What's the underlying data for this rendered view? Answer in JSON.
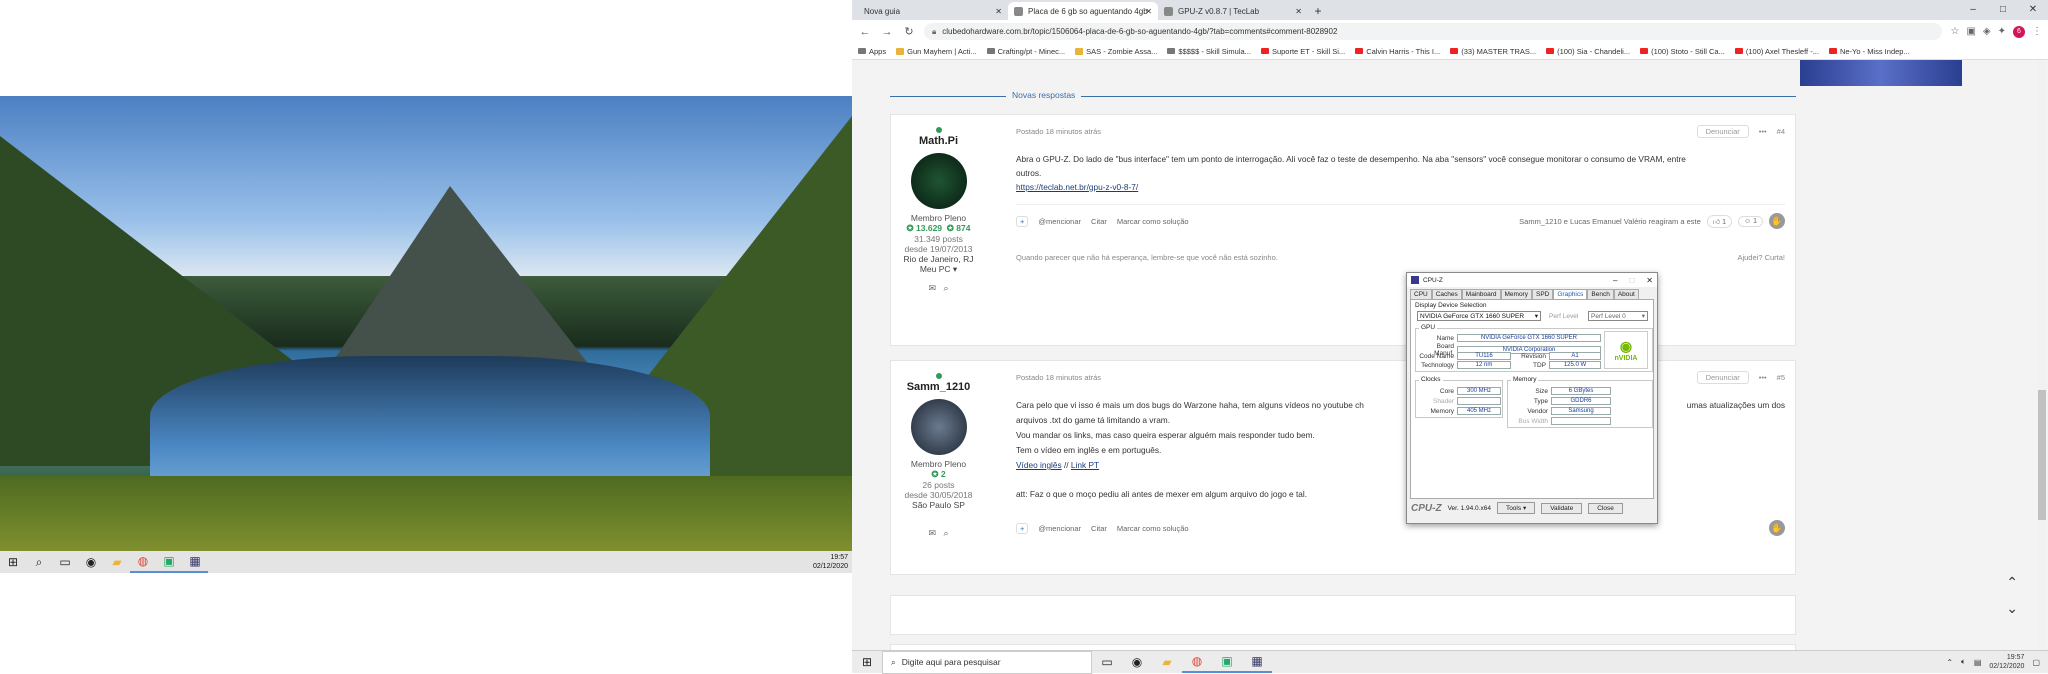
{
  "left_screen": {
    "taskbar": {
      "icons": [
        "windows-icon",
        "search-icon",
        "task-view-icon",
        "steam-icon",
        "folder-icon",
        "chrome-icon",
        "gpu-tool-icon",
        "cpuz-icon"
      ],
      "time": "19:57",
      "date": "02/12/2020"
    }
  },
  "browser": {
    "tabs": [
      {
        "label": "Nova guia",
        "active": false
      },
      {
        "label": "Placa de 6 gb so aguentando 4gb",
        "active": true
      },
      {
        "label": "GPU-Z v0.8.7 | TecLab",
        "active": false
      }
    ],
    "new_tab": "+",
    "url": "clubedohardware.com.br/topic/1506064-placa-de-6-gb-so-aguentando-4gb/?tab=comments#comment-8028902",
    "bookmarks": [
      "Apps",
      "Gun Mayhem | Acti...",
      "Crafting/pt - Minec...",
      "SAS - Zombie Assa...",
      "$$$$$ - Skill Simula...",
      "Suporte ET - Skill Si...",
      "Calvin Harris - This I...",
      "(33) MASTER TRAS...",
      "(100) Sia - Chandeli...",
      "(100) Stoto - Still Ca...",
      "(100) Axel Thesleff -...",
      "Ne-Yo - Miss Indep..."
    ],
    "avatar_letter": "6"
  },
  "forum": {
    "divider_label": "Novas respostas",
    "posts": [
      {
        "author": "Math.Pi",
        "rank": "Membro Pleno",
        "rep1": "13.629",
        "rep2": "874",
        "posts": "31.349 posts",
        "since": "desde 19/07/2013",
        "location": "Rio de Janeiro, RJ",
        "mypc": "Meu PC ▾",
        "posted": "Postado 18 minutos atrás",
        "report": "Denunciar",
        "number": "#4",
        "text1": "Abra o GPU-Z. Do lado de \"bus interface\" tem um ponto de interrogação. Ali você faz o teste de desempenho. Na aba \"sensors\" você consegue monitorar o consumo de VRAM, entre",
        "text2": "outros.",
        "link": "https://teclab.net.br/gpu-z-v0-8-7/",
        "mention": "@mencionar",
        "quote": "Citar",
        "solution": "Marcar como solução",
        "reacted": "Samm_1210 e Lucas Emanuel Valério reagiram a este",
        "react1": "1",
        "react2": "1",
        "signature": "Quando parecer que não há esperança, lembre-se que você não está sozinho.",
        "helped": "Ajudei? Curta!"
      },
      {
        "author": "Samm_1210",
        "rank": "Membro Pleno",
        "rep1": "2",
        "posts": "26 posts",
        "since": "desde 30/05/2018",
        "location": "São Paulo SP",
        "posted": "Postado 18 minutos atrás",
        "report": "Denunciar",
        "number": "#5",
        "line1": "Cara pelo que vi isso é mais um dos bugs do Warzone haha, tem alguns vídeos no youtube ch",
        "line1b": "umas atualizações um dos",
        "line2": "arquivos .txt do game tá limitando a vram.",
        "line3": "Vou mandar os links, mas caso queira esperar alguém mais responder tudo bem.",
        "line4": "Tem o vídeo em inglês e em português.",
        "link1": "Vídeo inglês",
        "sep": "//",
        "link2": "Link PT",
        "line5": "att: Faz o que o moço pediu ali antes de mexer em algum arquivo do jogo e tal.",
        "mention": "@mencionar",
        "quote": "Citar",
        "solution": "Marcar como solução"
      }
    ]
  },
  "right_taskbar": {
    "search_placeholder": "Digite aqui para pesquisar",
    "time": "19:57",
    "date": "02/12/2020"
  },
  "cpuz": {
    "title": "CPU-Z",
    "tabs": [
      "CPU",
      "Caches",
      "Mainboard",
      "Memory",
      "SPD",
      "Graphics",
      "Bench",
      "About"
    ],
    "active_tab": "Graphics",
    "display_device_label": "Display Device Selection",
    "device": "NVIDIA GeForce GTX 1660 SUPER",
    "perf_label": "Perf Level",
    "perf_value": "Perf Level 0",
    "gpu_group": "GPU",
    "name_label": "Name",
    "name_value": "NVIDIA GeForce GTX 1660 SUPER",
    "board_label": "Board Manuf.",
    "board_value": "NVIDIA Corporation",
    "code_label": "Code Name",
    "code_value": "TU116",
    "revision_label": "Revision",
    "revision_value": "A1",
    "tech_label": "Technology",
    "tech_value": "12 nm",
    "tdp_label": "TDP",
    "tdp_value": "125.0 W",
    "clocks_group": "Clocks",
    "core_label": "Core",
    "core_value": "300 MHz",
    "shader_label": "Shader",
    "memclk_label": "Memory",
    "memclk_value": "405 MHz",
    "memory_group": "Memory",
    "size_label": "Size",
    "size_value": "6 GBytes",
    "type_label": "Type",
    "type_value": "GDDR6",
    "vendor_label": "Vendor",
    "vendor_value": "Samsung",
    "bus_label": "Bus Width",
    "brand": "CPU-Z",
    "version": "Ver. 1.94.0.x64",
    "tools": "Tools",
    "validate": "Validate",
    "close": "Close"
  }
}
